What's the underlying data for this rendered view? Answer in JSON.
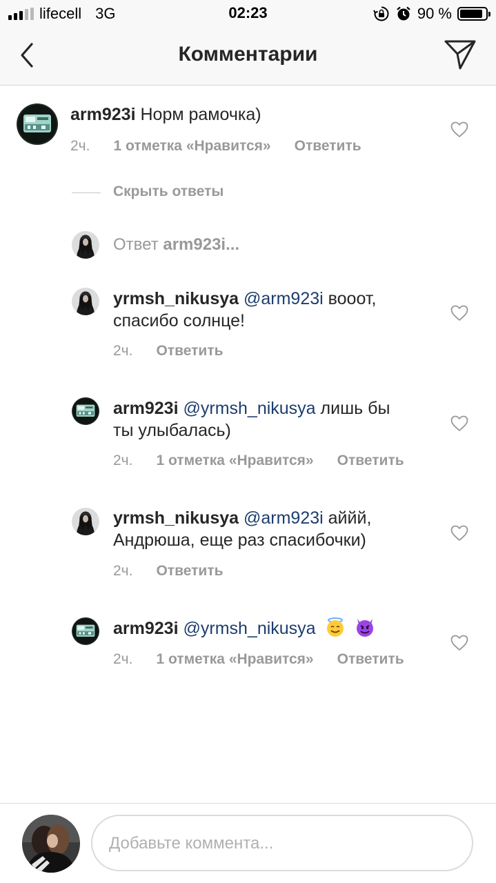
{
  "status_bar": {
    "carrier": "lifecell",
    "network": "3G",
    "time": "02:23",
    "battery": "90 %",
    "battery_level": 0.9,
    "icons": [
      "signal-icon",
      "rotation-lock-icon",
      "alarm-icon",
      "battery-icon"
    ]
  },
  "header": {
    "title": "Комментарии",
    "back_icon": "chevron-left-icon",
    "send_icon": "paper-plane-icon"
  },
  "main_comment": {
    "username": "arm923i",
    "text": "Норм рамочка)",
    "time": "2ч.",
    "likes": "1 отметка «Нравится»",
    "reply": "Ответить"
  },
  "hide_replies": "Скрыть ответы",
  "reply_prompt": {
    "prefix": "Ответ",
    "user": "arm923i..."
  },
  "replies": [
    {
      "username": "yrmsh_nikusya",
      "mention": "@arm923i",
      "text_line1": "вооот,",
      "text_line2": "спасибо солнце!",
      "time": "2ч.",
      "likes": "",
      "reply": "Ответить"
    },
    {
      "username": "arm923i",
      "mention": "@yrmsh_nikusya",
      "text_line1": "лишь бы",
      "text_line2": "ты улыбалась)",
      "time": "2ч.",
      "likes": "1 отметка «Нравится»",
      "reply": "Ответить"
    },
    {
      "username": "yrmsh_nikusya",
      "mention": "@arm923i",
      "text_line1": "аййй,",
      "text_line2": "Андрюша, еще раз спасибочки)",
      "time": "2ч.",
      "likes": "",
      "reply": "Ответить"
    },
    {
      "username": "arm923i",
      "mention": "@yrmsh_nikusya",
      "emojis": [
        "smiling-face-with-halo-icon",
        "smiling-imp-icon"
      ],
      "time": "2ч.",
      "likes": "1 отметка «Нравится»",
      "reply": "Ответить"
    }
  ],
  "composer": {
    "placeholder": "Добавьте коммента..."
  },
  "colors": {
    "text": "#262626",
    "secondary": "#999999",
    "mention": "#1d3d6e",
    "bar_bg": "#f8f8f8",
    "divider": "#dbdbdb"
  }
}
